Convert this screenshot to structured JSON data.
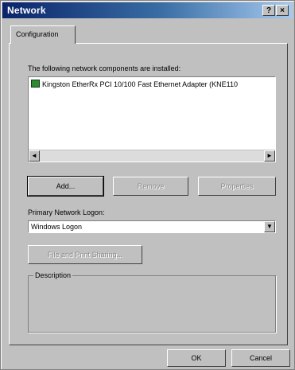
{
  "window": {
    "title": "Network",
    "help_button": "?",
    "close_button": "×"
  },
  "tabs": [
    {
      "label": "Configuration"
    }
  ],
  "components": {
    "label": "The following network components are installed:",
    "items": [
      {
        "label": "Kingston EtherRx PCI 10/100 Fast Ethernet Adapter (KNE110"
      }
    ]
  },
  "buttons": {
    "add": "Add...",
    "remove": "Remove",
    "properties": "Properties",
    "file_print_sharing": "File and Print Sharing...",
    "ok": "OK",
    "cancel": "Cancel"
  },
  "primary_logon": {
    "label": "Primary Network Logon:",
    "value": "Windows Logon"
  },
  "description": {
    "label": "Description"
  }
}
